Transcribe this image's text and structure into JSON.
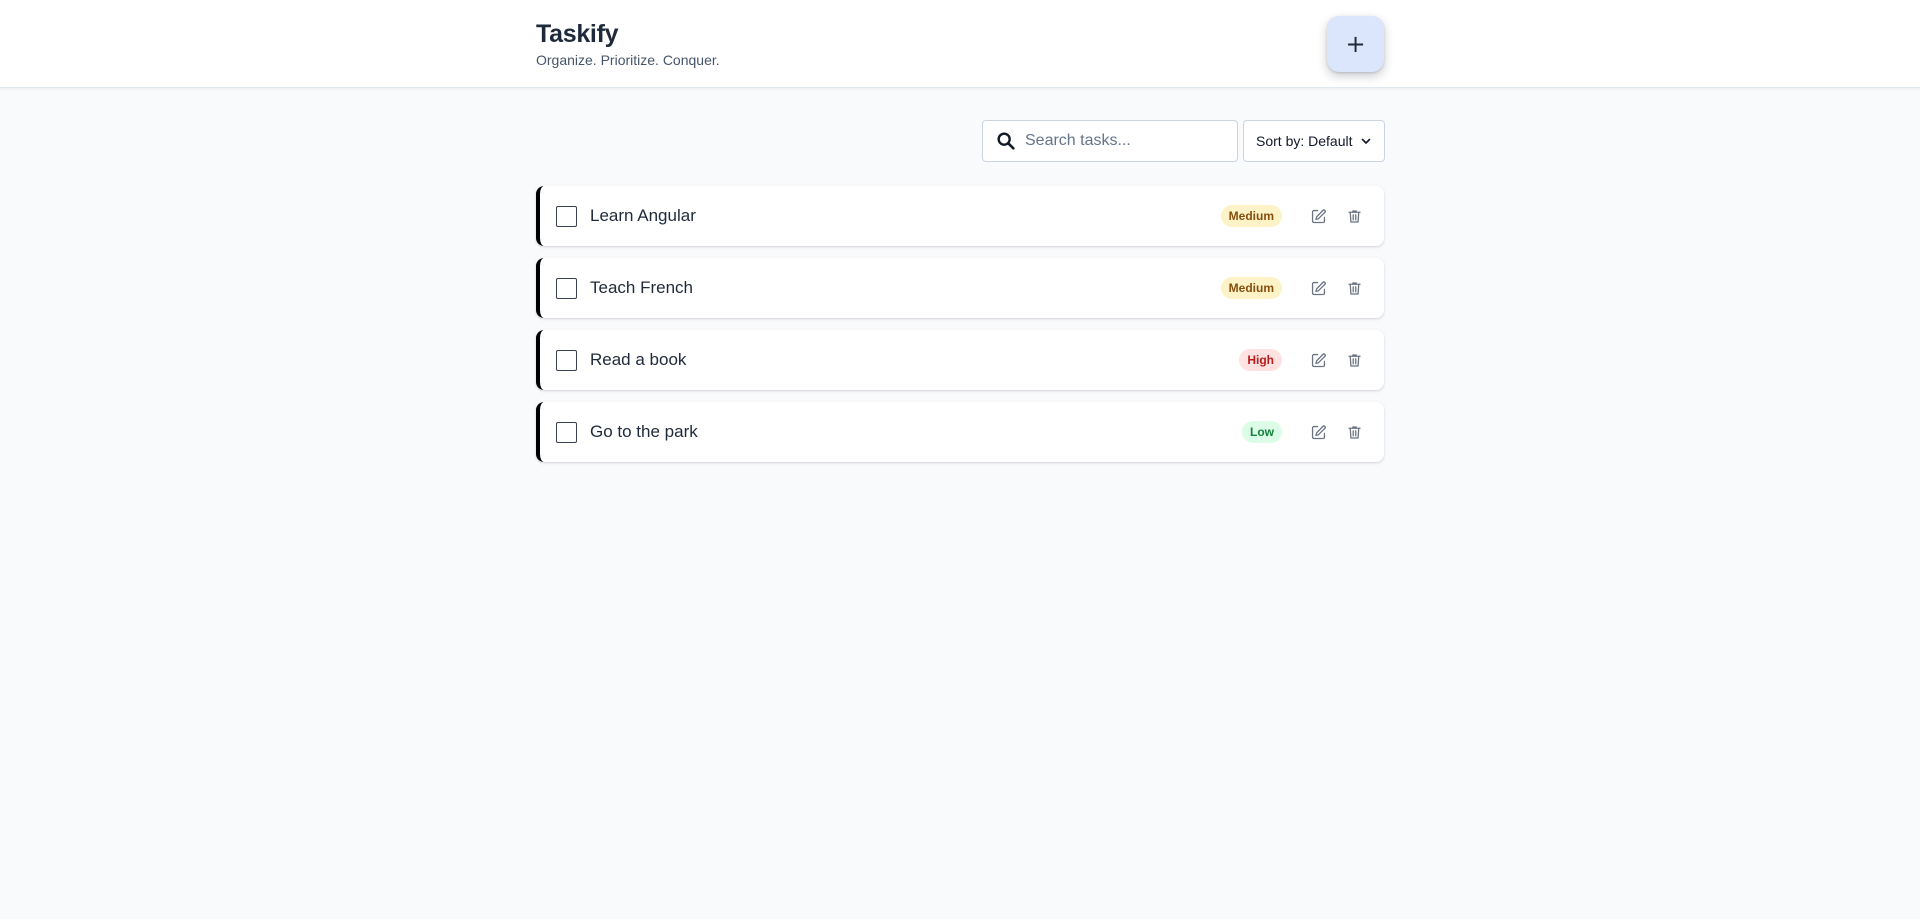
{
  "header": {
    "title": "Taskify",
    "tagline": "Organize. Prioritize. Conquer.",
    "add_label": "+"
  },
  "toolbar": {
    "search_placeholder": "Search tasks...",
    "sort_label": "Sort by: Default"
  },
  "tasks": [
    {
      "title": "Learn Angular",
      "priority": "Medium"
    },
    {
      "title": "Teach French",
      "priority": "Medium"
    },
    {
      "title": "Read a book",
      "priority": "High"
    },
    {
      "title": "Go to the park",
      "priority": "Low"
    }
  ],
  "icons": {
    "add": "plus-icon",
    "search": "search-icon",
    "sort": "chevron-down-icon",
    "edit": "edit-icon",
    "delete": "trash-icon"
  },
  "colors": {
    "medium_bg": "#fef3c7",
    "medium_fg": "#92400e",
    "high_bg": "#fee2e2",
    "high_fg": "#b91c1c",
    "low_bg": "#dcfce7",
    "low_fg": "#15803d",
    "accent_bar": "#000000"
  }
}
